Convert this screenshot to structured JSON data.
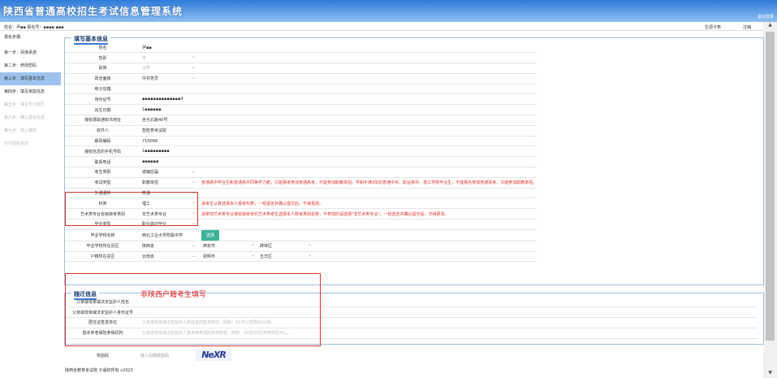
{
  "app": {
    "title": "陕西省普通高校招生考试信息管理系统"
  },
  "top": {
    "logout": "退出登录"
  },
  "user": {
    "info": "姓名：尹▪▪  报名号：▪▪▪▪ ▪▪▪",
    "print": "生源卡表",
    "logout": "注销"
  },
  "sidebar": {
    "heading": "报名步骤:",
    "steps": [
      {
        "label": "第一步：阅读承诺",
        "state": "done"
      },
      {
        "label": "第二步：修改密码",
        "state": "done"
      },
      {
        "label": "第三步：填写基本信息",
        "state": "active"
      },
      {
        "label": "第四步：填写家庭信息",
        "state": "done"
      },
      {
        "label": "第五步：填写学习简历",
        "state": "disabled"
      },
      {
        "label": "第六步：确认报名信息",
        "state": "disabled"
      },
      {
        "label": "第七步：网上缴费",
        "state": "disabled"
      },
      {
        "label": "打印报名信息",
        "state": "disabled"
      }
    ]
  },
  "basic": {
    "legend": "填写基本信息",
    "name": {
      "label": "姓名",
      "value": "尹▪▪"
    },
    "gender": {
      "label": "性别",
      "value": "男"
    },
    "ethnicity": {
      "label": "民族",
      "value": "汉族"
    },
    "politics": {
      "label": "政治面貌",
      "value": "中共党员"
    },
    "email": {
      "label": "电子信箱",
      "value": ""
    },
    "idcard": {
      "label": "身份证号",
      "value": "▪▪▪▪▪▪▪▪▪▪▪▪▪▪4"
    },
    "birth": {
      "label": "出生日期",
      "value": "1▪▪▪▪▪▪"
    },
    "address": {
      "label": "接收录取通知书地址",
      "value": "含光北路40号"
    },
    "recipient": {
      "label": "收件人",
      "value": "智胜育考试院"
    },
    "postcode": {
      "label": "邮政编码",
      "value": "710068"
    },
    "mobile": {
      "label": "接收信息的手机号码",
      "value": "1▪▪▪▪▪▪▪▪▪"
    },
    "phone": {
      "label": "联系电话",
      "value": "▪▪▪▪▪▪"
    },
    "category": {
      "label": "考生类别",
      "value": "城镇应届"
    },
    "exam_type": {
      "label": "考试类型",
      "value": "职教单招",
      "hint": "普通高中毕业生和普通高中同等学力者，只能报考参加普通高考，不能参加职教单招。学制不满3年的普通中专、职业高中、技工学校毕业生，不能报名参加普通高考，只能参加职教单招。"
    },
    "language": {
      "label": "外语语种",
      "value": "英语"
    },
    "subject": {
      "label": "科类",
      "value": "理工",
      "hint": "请考生认真选择本人报考科类，一经选定并确认提交后，不得更改。"
    },
    "art": {
      "label": "艺术类专业省级统考类别",
      "value": "非艺术类专业",
      "hint": "请参加艺术类专业课省级统考的艺术类考生选择本人统考类别名称，不参加的请选择\"非艺术类专业\"，一经选定并确认提交后，不得更改。"
    },
    "grad_type": {
      "label": "毕业类型",
      "value": "职业高中毕业"
    },
    "school": {
      "label": "毕业学校名称",
      "value": "西北工业大学附属中学",
      "button": "选择"
    },
    "school_region": {
      "label": "毕业学校所在县区",
      "province": "陕西省",
      "city": "西安市",
      "district": "碑林区"
    },
    "hukou_region": {
      "label": "户籍所在县区",
      "province": "云南省",
      "city": "昆明市",
      "district": "五华区"
    }
  },
  "guardian": {
    "legend": "随迁信息",
    "annotation": "非陕西户籍考生填写",
    "name": {
      "label": "父亲或母亲或法定监护人姓名",
      "value": ""
    },
    "idcard": {
      "label": "父亲或母亲或法定监护人身份证号",
      "value": ""
    },
    "residence": {
      "label": "居住证签发单位",
      "placeholder": "父亲或母亲或法定监护人居住证的签发单位，例如：XX市公安局XX分局。"
    },
    "insurance": {
      "label": "基本养老保险参保机构",
      "placeholder": "父亲或母亲或法定监护人基本养老保险参保机构，例如：XX市XX区养老保险中心。"
    }
  },
  "captcha": {
    "label": "校验码",
    "placeholder": "输入右侧校验码",
    "image_text": "NeXR"
  },
  "footer": {
    "copyright": "陕西省教育考试院 ©版权所有 v2023"
  }
}
